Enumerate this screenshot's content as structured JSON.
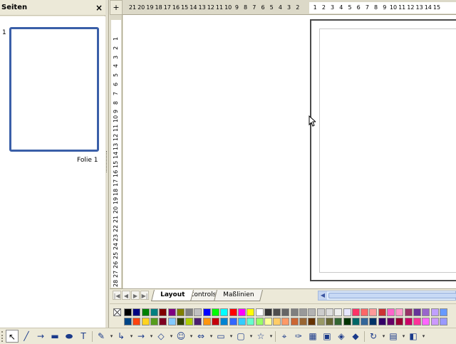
{
  "pages_panel": {
    "title": "Seiten",
    "close_symbol": "×",
    "slides": [
      {
        "number": "1",
        "label": "Folie 1"
      }
    ]
  },
  "rulers": {
    "corner_symbol": "+",
    "horizontal_labels": [
      "21",
      "20",
      "19",
      "18",
      "17",
      "16",
      "15",
      "14",
      "13",
      "12",
      "11",
      "10",
      "9",
      "8",
      "7",
      "6",
      "5",
      "4",
      "3",
      "2",
      "",
      "1",
      "2",
      "3",
      "4",
      "5",
      "6",
      "7",
      "8",
      "9",
      "10",
      "11",
      "12",
      "13",
      "14",
      "15"
    ],
    "vertical_labels": [
      "1",
      "2",
      "3",
      "4",
      "5",
      "6",
      "7",
      "8",
      "9",
      "10",
      "11",
      "12",
      "13",
      "14",
      "15",
      "16",
      "17",
      "18",
      "19",
      "20",
      "21",
      "22",
      "23",
      "24",
      "25",
      "26",
      "27",
      "28",
      "29"
    ]
  },
  "tabs": {
    "nav": [
      "|◀",
      "◀",
      "▶",
      "▶|"
    ],
    "items": [
      {
        "label": "Layout",
        "active": true
      },
      {
        "label": "Controls",
        "active": false
      },
      {
        "label": "Maßlinien",
        "active": false
      }
    ],
    "scroll_left": "◀"
  },
  "color_bar": {
    "rows": [
      [
        "#000000",
        "#000080",
        "#008000",
        "#008080",
        "#800000",
        "#800080",
        "#808000",
        "#808080",
        "#c0c0c0",
        "#0000ff",
        "#00ff00",
        "#00ffff",
        "#ff0000",
        "#ff00ff",
        "#ffff00",
        "#ffffff",
        "#333333",
        "#4d4d4d",
        "#666666",
        "#7f7f7f",
        "#999999",
        "#b2b2b2",
        "#cccccc",
        "#dddddd",
        "#eeeeee",
        "#e6e6ff",
        "#ff3366",
        "#ff6666",
        "#ff9999",
        "#cc3333",
        "#ff66cc",
        "#ff99cc",
        "#993366",
        "#663399",
        "#9966cc",
        "#c0a0ff",
        "#6699ff",
        "#99ccff",
        "#ccccff"
      ],
      [
        "#004586",
        "#ff420e",
        "#ffd320",
        "#579d1c",
        "#7e0021",
        "#83caff",
        "#314004",
        "#aecf00",
        "#4b1f6f",
        "#ff950e",
        "#c5000b",
        "#0084d1",
        "#3366ff",
        "#33ccff",
        "#66ffcc",
        "#99ff66",
        "#ffff99",
        "#ffcc66",
        "#ff9966",
        "#cc6633",
        "#996633",
        "#663300",
        "#999966",
        "#666633",
        "#336633",
        "#003300",
        "#006666",
        "#336699",
        "#003366",
        "#330066",
        "#660066",
        "#990033",
        "#cc0066",
        "#ff3399",
        "#ff66ff",
        "#cc99ff",
        "#9999ff",
        "#6666cc",
        "#333399"
      ]
    ]
  },
  "drawing_toolbar": {
    "tools": [
      {
        "icon": "select-arrow-icon",
        "glyph": "↖",
        "selected": true
      },
      {
        "icon": "line-icon",
        "glyph": "╱"
      },
      {
        "icon": "arrow-line-icon",
        "glyph": "→"
      },
      {
        "icon": "rectangle-icon",
        "glyph": "▬"
      },
      {
        "icon": "ellipse-icon",
        "glyph": "⬬"
      },
      {
        "icon": "text-icon",
        "glyph": "T"
      },
      {
        "icon": "curve-icon",
        "glyph": "✎"
      },
      {
        "icon": "connector-icon",
        "glyph": "↳"
      },
      {
        "icon": "lines-arrows-icon",
        "glyph": "→"
      },
      {
        "icon": "basic-shapes-icon",
        "glyph": "◇"
      },
      {
        "icon": "symbol-shapes-icon",
        "glyph": "☺"
      },
      {
        "icon": "block-arrows-icon",
        "glyph": "⇔"
      },
      {
        "icon": "flowchart-icon",
        "glyph": "▭"
      },
      {
        "icon": "callouts-icon",
        "glyph": "▢"
      },
      {
        "icon": "stars-icon",
        "glyph": "☆"
      },
      {
        "icon": "points-icon",
        "glyph": "⌖"
      },
      {
        "icon": "glue-points-icon",
        "glyph": "✑"
      },
      {
        "icon": "fontwork-icon",
        "glyph": "▦"
      },
      {
        "icon": "from-file-icon",
        "glyph": "▣"
      },
      {
        "icon": "gallery-icon",
        "glyph": "◈"
      },
      {
        "icon": "3d-objects-icon",
        "glyph": "◆"
      },
      {
        "icon": "rotate-icon",
        "glyph": "↻"
      },
      {
        "icon": "alignment-icon",
        "glyph": "▤"
      },
      {
        "icon": "arrange-icon",
        "glyph": "◧"
      }
    ]
  }
}
